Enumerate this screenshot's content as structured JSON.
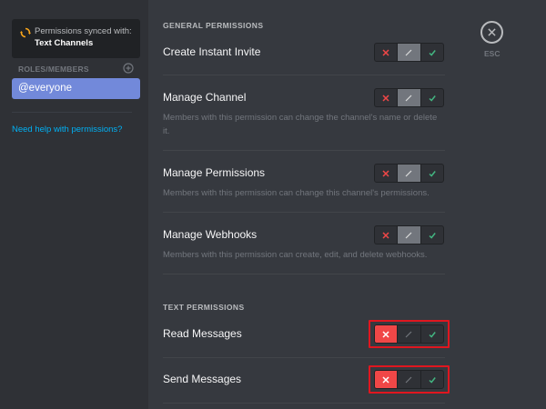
{
  "sidebar": {
    "sync_line1": "Permissions synced with:",
    "sync_line2": "Text Channels",
    "roles_header": "ROLES/MEMBERS",
    "selected_role": "@everyone",
    "help_link": "Need help with permissions?"
  },
  "close": {
    "label": "ESC"
  },
  "sections": {
    "general": "GENERAL PERMISSIONS",
    "text": "TEXT PERMISSIONS"
  },
  "permissions": [
    {
      "title": "Create Instant Invite",
      "desc": "",
      "state": "neutral"
    },
    {
      "title": "Manage Channel",
      "desc": "Members with this permission can change the channel's name or delete it.",
      "state": "neutral"
    },
    {
      "title": "Manage Permissions",
      "desc": "Members with this permission can change this channel's permissions.",
      "state": "neutral"
    },
    {
      "title": "Manage Webhooks",
      "desc": "Members with this permission can create, edit, and delete webhooks.",
      "state": "neutral"
    },
    {
      "title": "Read Messages",
      "desc": "",
      "state": "deny"
    },
    {
      "title": "Send Messages",
      "desc": "",
      "state": "deny"
    }
  ],
  "colors": {
    "deny": "#f04747",
    "allow": "#43b581",
    "accent": "#7289da",
    "link": "#00b0f4",
    "highlight_box": "#e0161f"
  },
  "icons": {
    "sync": "sync-icon",
    "add_role": "add-circle-icon",
    "close": "close-icon",
    "deny": "x-icon",
    "neutral": "slash-icon",
    "allow": "check-icon"
  }
}
